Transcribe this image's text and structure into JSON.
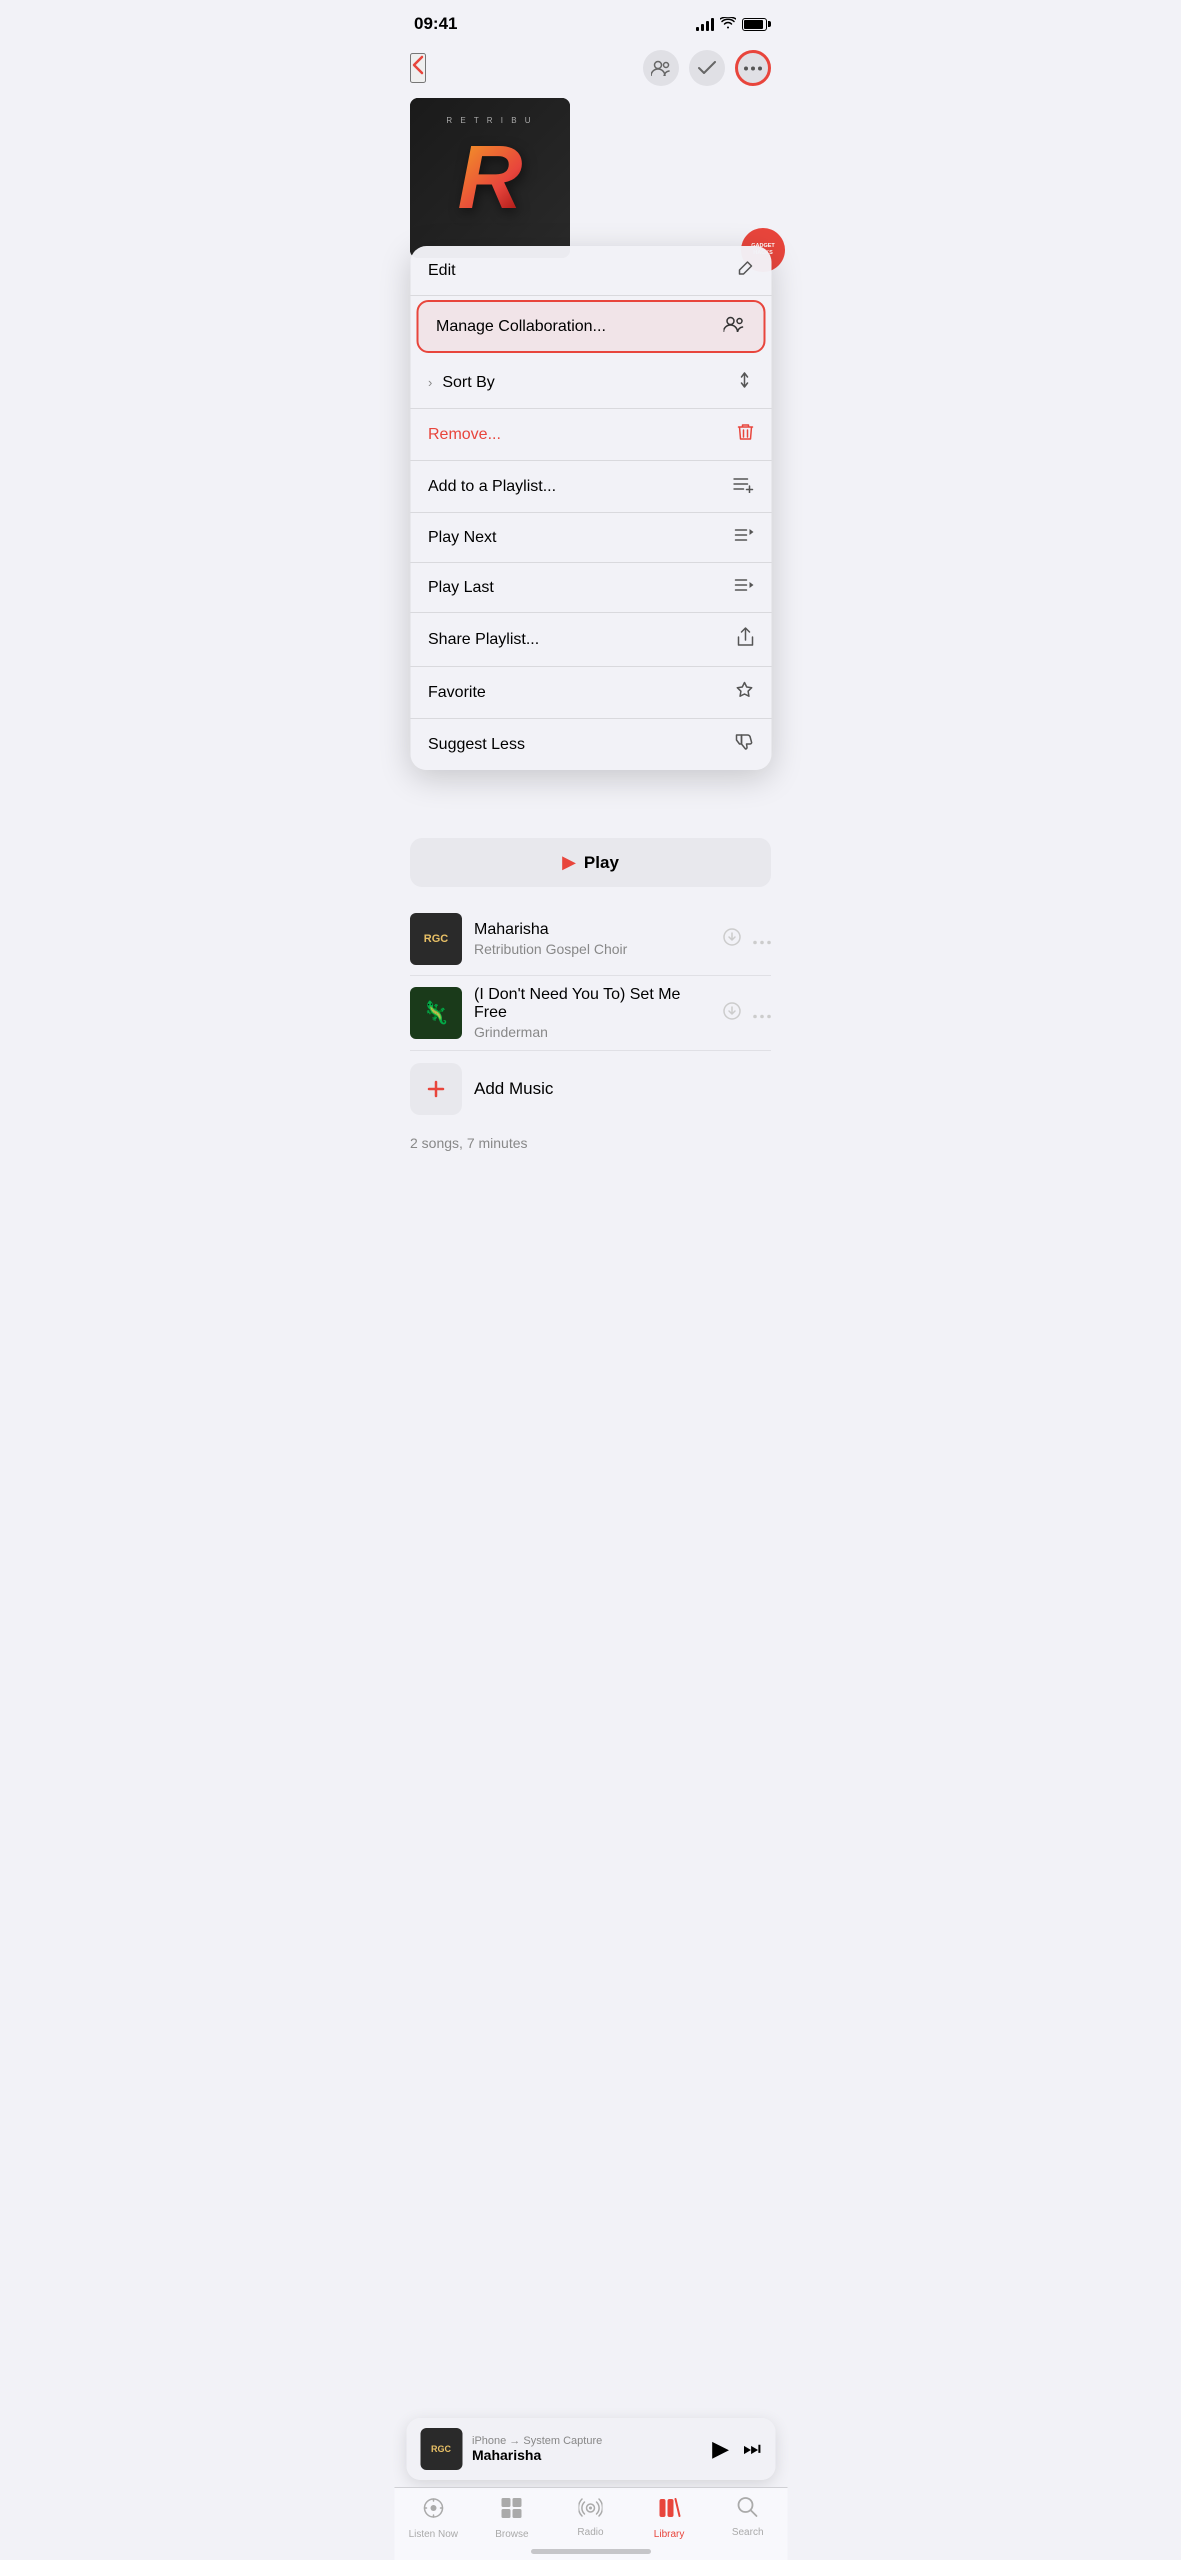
{
  "statusBar": {
    "time": "09:41",
    "signalBars": [
      4,
      7,
      10,
      13
    ],
    "hasBattery": true
  },
  "header": {
    "backLabel": "‹",
    "buttons": [
      {
        "id": "people",
        "icon": "👥",
        "highlighted": false
      },
      {
        "id": "check",
        "icon": "✓",
        "highlighted": false
      },
      {
        "id": "more",
        "icon": "•••",
        "highlighted": true
      }
    ]
  },
  "album": {
    "letter": "R",
    "topText": "R E T R I B U",
    "badgeTopLine": "GADGET",
    "badgeBottomLine": "HACKS"
  },
  "playButton": {
    "icon": "▶",
    "label": "Play"
  },
  "contextMenu": {
    "items": [
      {
        "id": "edit",
        "label": "Edit",
        "icon": "✏️",
        "iconText": "╱",
        "highlighted": false,
        "isRemove": false,
        "hasChevron": false
      },
      {
        "id": "manage-collaboration",
        "label": "Manage Collaboration...",
        "icon": "👥",
        "iconText": "👥",
        "highlighted": true,
        "isRemove": false,
        "hasChevron": false
      },
      {
        "id": "sort-by",
        "label": "Sort By",
        "icon": "↕",
        "iconText": "⇅",
        "highlighted": false,
        "isRemove": false,
        "hasChevron": true
      },
      {
        "id": "remove",
        "label": "Remove...",
        "icon": "🗑",
        "iconText": "🗑",
        "highlighted": false,
        "isRemove": true,
        "hasChevron": false
      },
      {
        "id": "add-to-playlist",
        "label": "Add to a Playlist...",
        "icon": "📋",
        "iconText": "☰+",
        "highlighted": false,
        "isRemove": false,
        "hasChevron": false
      },
      {
        "id": "play-next",
        "label": "Play Next",
        "icon": "☰",
        "iconText": "≡→",
        "highlighted": false,
        "isRemove": false,
        "hasChevron": false
      },
      {
        "id": "play-last",
        "label": "Play Last",
        "icon": "☰",
        "iconText": "≡↓",
        "highlighted": false,
        "isRemove": false,
        "hasChevron": false
      },
      {
        "id": "share-playlist",
        "label": "Share Playlist...",
        "icon": "⬆",
        "iconText": "⬆",
        "highlighted": false,
        "isRemove": false,
        "hasChevron": false
      },
      {
        "id": "favorite",
        "label": "Favorite",
        "icon": "☆",
        "iconText": "☆",
        "highlighted": false,
        "isRemove": false,
        "hasChevron": false
      },
      {
        "id": "suggest-less",
        "label": "Suggest Less",
        "icon": "👎",
        "iconText": "👎",
        "highlighted": false,
        "isRemove": false,
        "hasChevron": false
      }
    ]
  },
  "songs": [
    {
      "id": "maharisha",
      "title": "Maharisha",
      "artist": "Retribution Gospel Choir",
      "artworkType": "rgc",
      "artworkText": "RGC"
    },
    {
      "id": "set-me-free",
      "title": "(I Don't Need You To) Set Me Free",
      "artist": "Grinderman",
      "artworkType": "grinderman",
      "artworkEmoji": "🦎"
    }
  ],
  "addMusic": {
    "label": "Add Music"
  },
  "songsCount": "2 songs, 7 minutes",
  "miniPlayer": {
    "source": "iPhone → System Capture",
    "title": "Maharisha",
    "artworkText": "RGC"
  },
  "tabBar": {
    "tabs": [
      {
        "id": "listen-now",
        "label": "Listen Now",
        "icon": "▶",
        "active": false
      },
      {
        "id": "browse",
        "label": "Browse",
        "icon": "⊞",
        "active": false
      },
      {
        "id": "radio",
        "label": "Radio",
        "icon": "📡",
        "active": false
      },
      {
        "id": "library",
        "label": "Library",
        "icon": "📚",
        "active": true
      },
      {
        "id": "search",
        "label": "Search",
        "icon": "🔍",
        "active": false
      }
    ]
  }
}
